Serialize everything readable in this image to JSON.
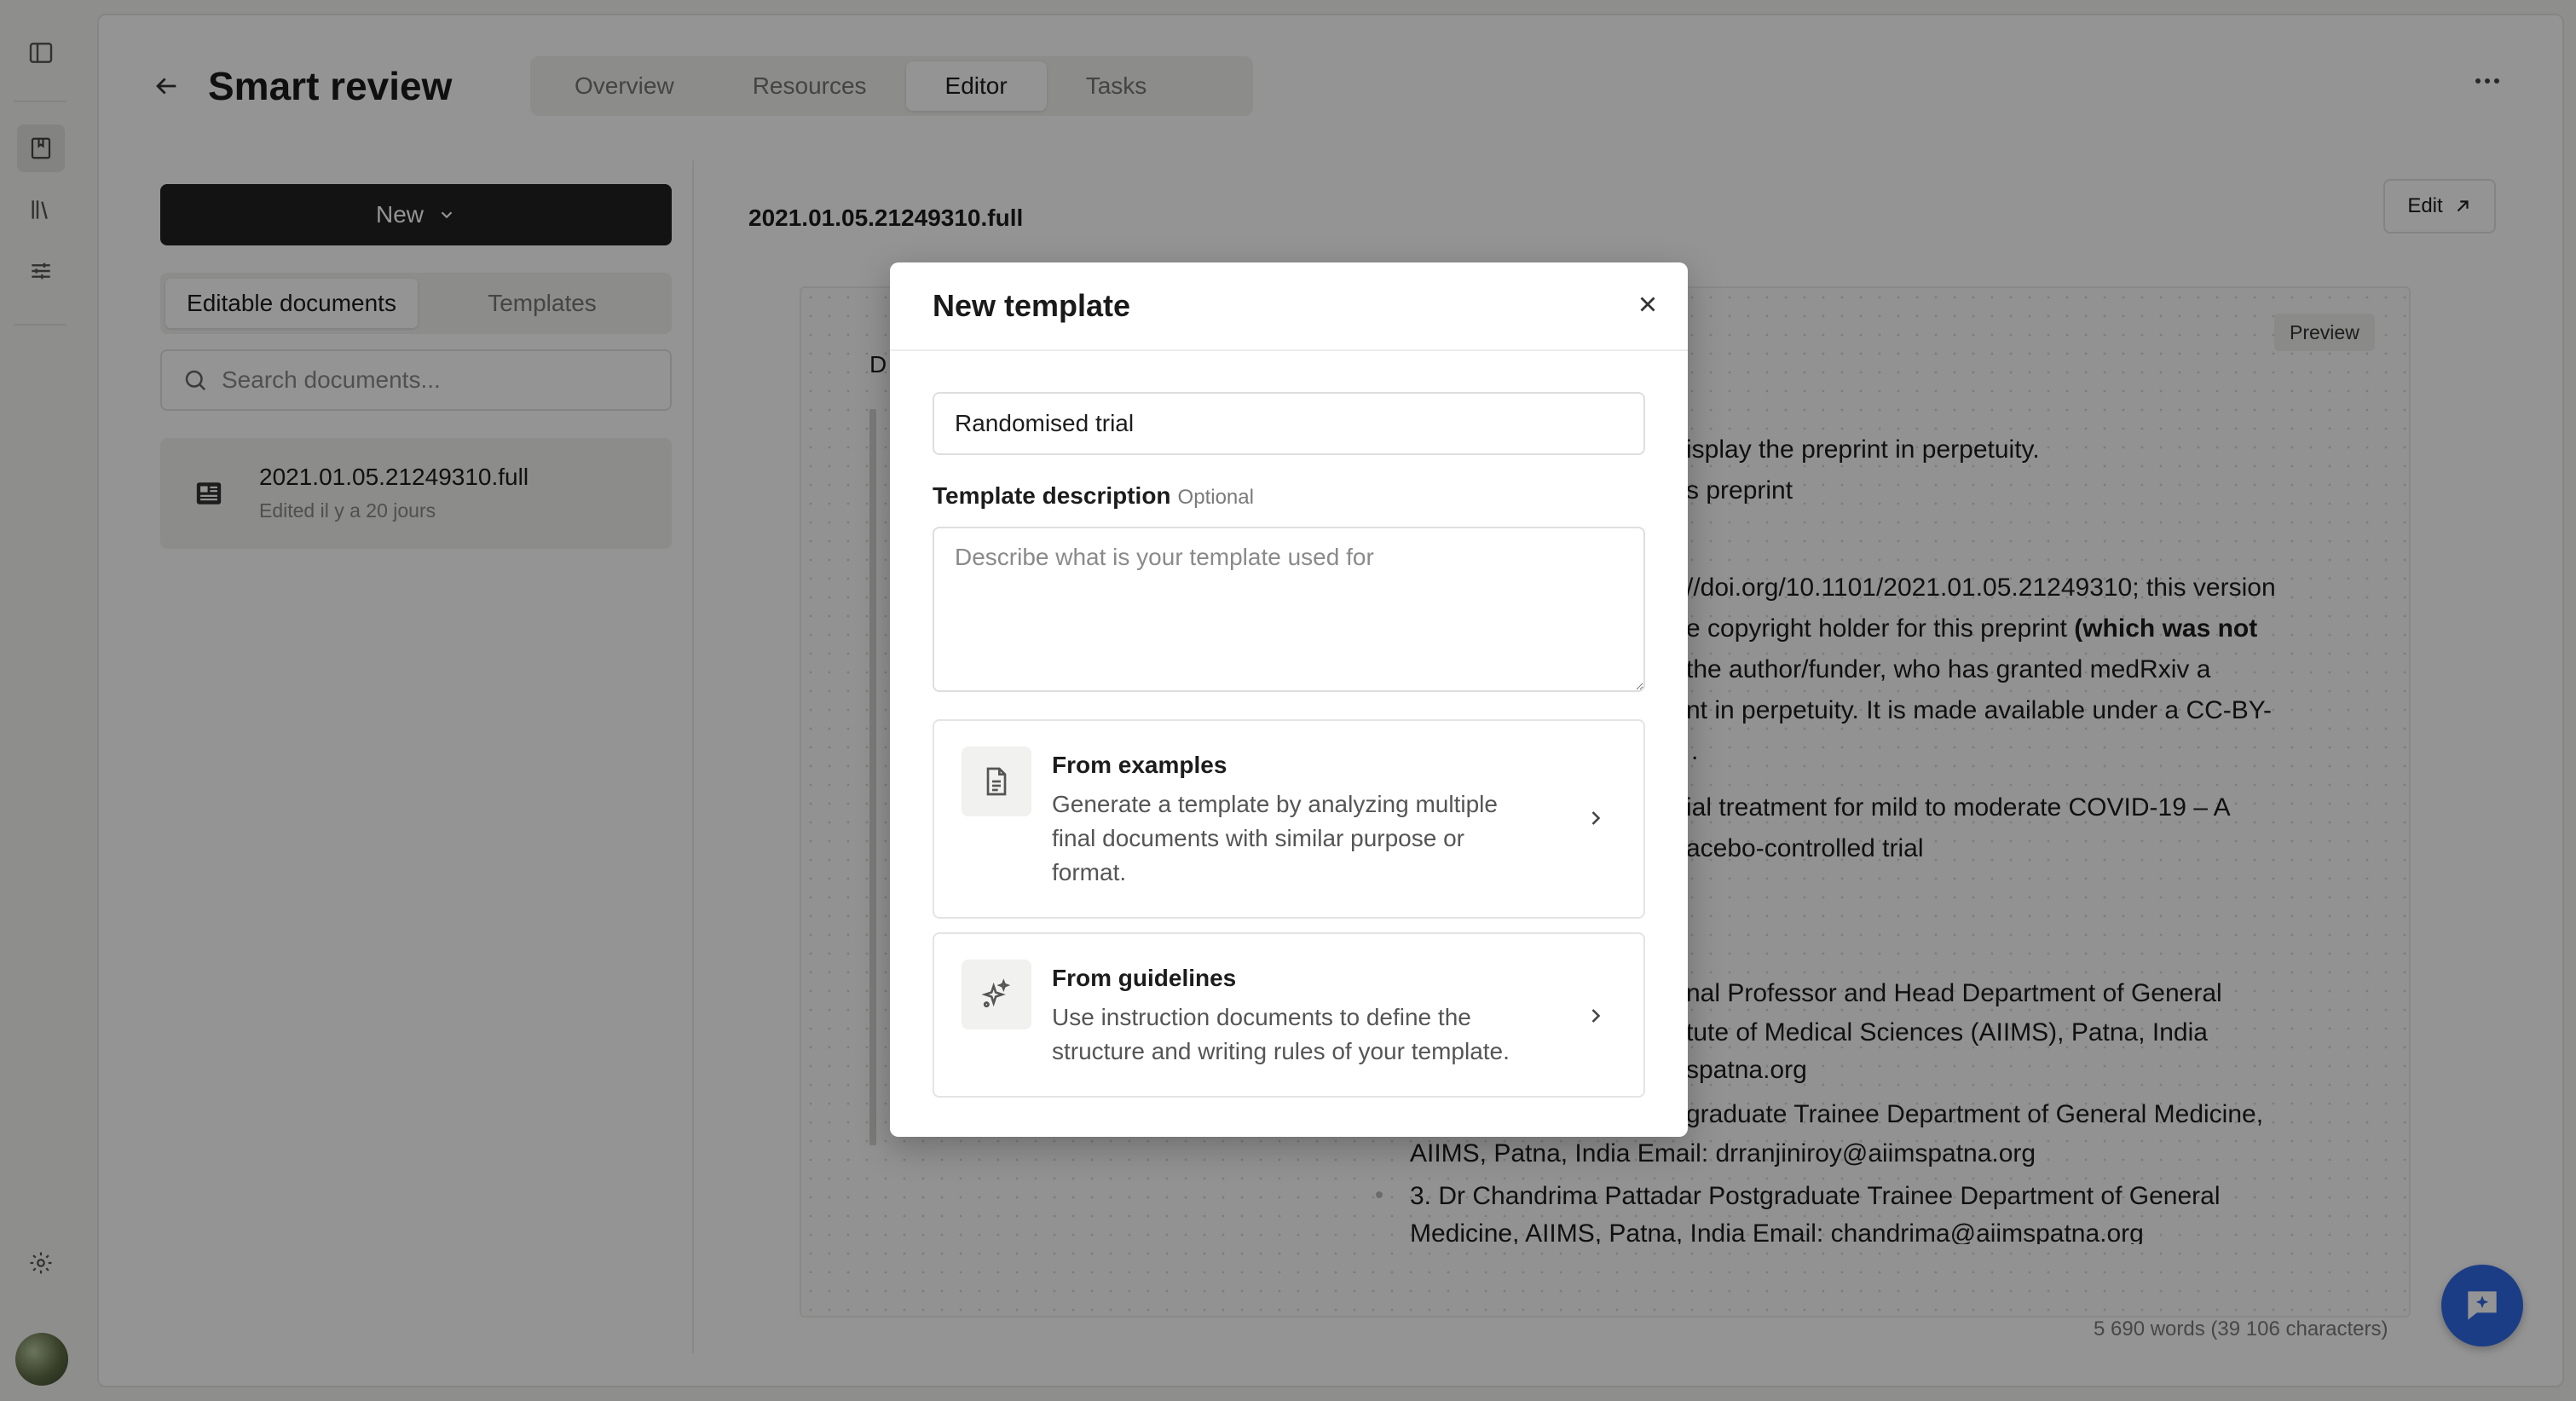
{
  "header": {
    "title": "Smart review",
    "tabs": [
      {
        "label": "Overview"
      },
      {
        "label": "Resources"
      },
      {
        "label": "Editor"
      },
      {
        "label": "Tasks"
      }
    ],
    "active_tab": "Editor"
  },
  "sidebar": {
    "new_label": "New",
    "segments": [
      {
        "label": "Editable documents"
      },
      {
        "label": "Templates"
      }
    ],
    "search_placeholder": "Search documents...",
    "documents": [
      {
        "name": "2021.01.05.21249310.full",
        "meta": "Edited il y a 20 jours"
      }
    ]
  },
  "editor": {
    "doc_title": "2021.01.05.21249310.full",
    "edit_label": "Edit",
    "preview_label": "Preview",
    "partial_letter": "D",
    "lines": [
      "isplay the preprint in perpetuity.",
      "s preprint",
      "//doi.org/10.1101/2021.01.05.21249310; this version",
      "e copyright holder for this preprint ",
      "(which was not",
      "the author/funder, who has granted medRxiv a",
      "nt in perpetuity. It is made available under a CC-BY-",
      ".",
      "ial treatment for mild to moderate COVID-19 – A",
      "acebo-controlled trial",
      "nal Professor and Head  Department of General",
      "tute of Medical Sciences (AIIMS), Patna, India",
      "spatna.org",
      "graduate Trainee  Department of General Medicine,",
      "AIIMS, Patna, India   Email:  drranjiniroy@aiimspatna.org",
      "3.   Dr Chandrima Pattadar  Postgraduate Trainee  Department of General",
      "Medicine, AIIMS, Patna, India  Email:  chandrima@aiimspatna.org"
    ],
    "word_count": "5 690 words   (39 106 characters)"
  },
  "modal": {
    "title": "New template",
    "name_value": "Randomised trial",
    "desc_label": "Template description",
    "desc_optional": "Optional",
    "desc_placeholder": "Describe what is your template used for",
    "options": [
      {
        "title": "From examples",
        "desc": "Generate a template by analyzing multiple final documents with similar purpose or format.",
        "icon": "document-icon"
      },
      {
        "title": "From guidelines",
        "desc": "Use instruction documents to define the structure and writing rules of your template.",
        "icon": "sparkles-icon"
      }
    ]
  },
  "colors": {
    "primary_button": "#222222",
    "chat_fab": "#2f6ae6",
    "overlay": "rgba(0,0,0,0.42)"
  }
}
